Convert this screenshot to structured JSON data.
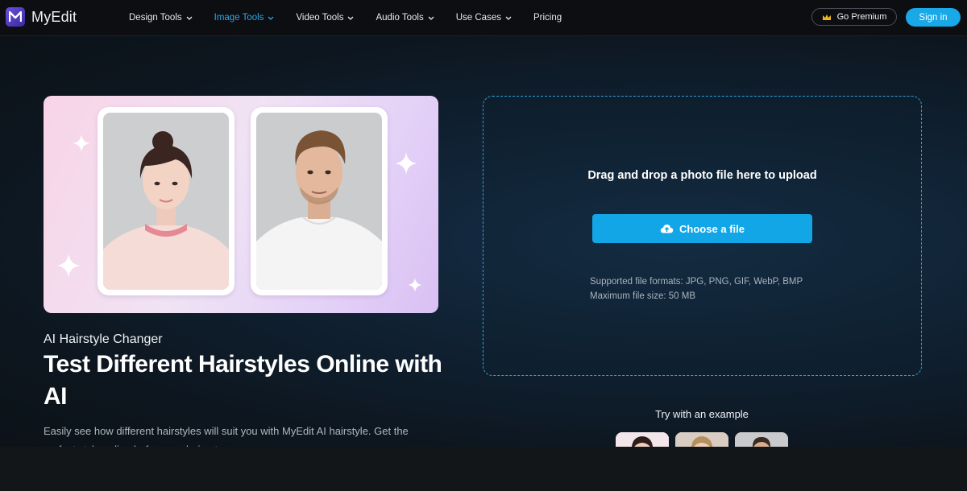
{
  "brand": {
    "name": "MyEdit"
  },
  "nav": {
    "items": [
      {
        "label": "Design Tools",
        "has_dropdown": true,
        "active": false
      },
      {
        "label": "Image Tools",
        "has_dropdown": true,
        "active": true
      },
      {
        "label": "Video Tools",
        "has_dropdown": true,
        "active": false
      },
      {
        "label": "Audio Tools",
        "has_dropdown": true,
        "active": false
      },
      {
        "label": "Use Cases",
        "has_dropdown": true,
        "active": false
      },
      {
        "label": "Pricing",
        "has_dropdown": false,
        "active": false
      }
    ],
    "premium_label": "Go Premium",
    "signin_label": "Sign in"
  },
  "hero": {
    "subtitle": "AI Hairstyle Changer",
    "title": "Test Different Hairstyles Online with AI",
    "description": "Easily see how different hairstyles will suit you with MyEdit AI hairstyle. Get the perfect style online before any haircut."
  },
  "upload": {
    "drop_text": "Drag and drop a photo file here to upload",
    "choose_label": "Choose a file",
    "formats_text": "Supported file formats: JPG, PNG, GIF, WebP, BMP",
    "max_size_text": "Maximum file size: 50 MB"
  },
  "examples": {
    "label": "Try with an example"
  },
  "colors": {
    "accent": "#19a8e8",
    "active_nav": "#2ba6ec",
    "background": "#101418"
  },
  "icons": [
    "logo-mark-icon",
    "chevron-down-icon",
    "crown-icon",
    "cloud-upload-icon",
    "sparkle-icon"
  ]
}
